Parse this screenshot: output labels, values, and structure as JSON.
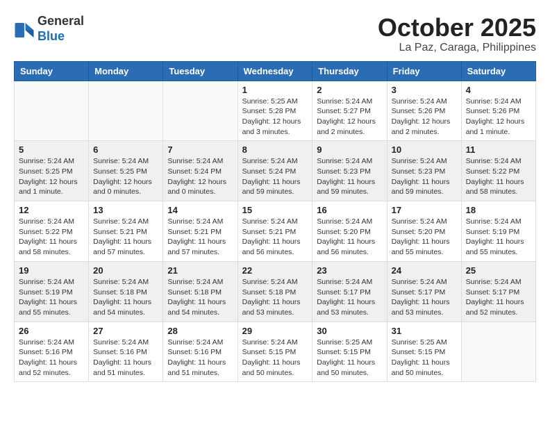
{
  "header": {
    "logo_line1": "General",
    "logo_line2": "Blue",
    "month": "October 2025",
    "location": "La Paz, Caraga, Philippines"
  },
  "weekdays": [
    "Sunday",
    "Monday",
    "Tuesday",
    "Wednesday",
    "Thursday",
    "Friday",
    "Saturday"
  ],
  "weeks": [
    [
      {
        "day": "",
        "sunrise": "",
        "sunset": "",
        "daylight": ""
      },
      {
        "day": "",
        "sunrise": "",
        "sunset": "",
        "daylight": ""
      },
      {
        "day": "",
        "sunrise": "",
        "sunset": "",
        "daylight": ""
      },
      {
        "day": "1",
        "sunrise": "Sunrise: 5:25 AM",
        "sunset": "Sunset: 5:28 PM",
        "daylight": "Daylight: 12 hours and 3 minutes."
      },
      {
        "day": "2",
        "sunrise": "Sunrise: 5:24 AM",
        "sunset": "Sunset: 5:27 PM",
        "daylight": "Daylight: 12 hours and 2 minutes."
      },
      {
        "day": "3",
        "sunrise": "Sunrise: 5:24 AM",
        "sunset": "Sunset: 5:26 PM",
        "daylight": "Daylight: 12 hours and 2 minutes."
      },
      {
        "day": "4",
        "sunrise": "Sunrise: 5:24 AM",
        "sunset": "Sunset: 5:26 PM",
        "daylight": "Daylight: 12 hours and 1 minute."
      }
    ],
    [
      {
        "day": "5",
        "sunrise": "Sunrise: 5:24 AM",
        "sunset": "Sunset: 5:25 PM",
        "daylight": "Daylight: 12 hours and 1 minute."
      },
      {
        "day": "6",
        "sunrise": "Sunrise: 5:24 AM",
        "sunset": "Sunset: 5:25 PM",
        "daylight": "Daylight: 12 hours and 0 minutes."
      },
      {
        "day": "7",
        "sunrise": "Sunrise: 5:24 AM",
        "sunset": "Sunset: 5:24 PM",
        "daylight": "Daylight: 12 hours and 0 minutes."
      },
      {
        "day": "8",
        "sunrise": "Sunrise: 5:24 AM",
        "sunset": "Sunset: 5:24 PM",
        "daylight": "Daylight: 11 hours and 59 minutes."
      },
      {
        "day": "9",
        "sunrise": "Sunrise: 5:24 AM",
        "sunset": "Sunset: 5:23 PM",
        "daylight": "Daylight: 11 hours and 59 minutes."
      },
      {
        "day": "10",
        "sunrise": "Sunrise: 5:24 AM",
        "sunset": "Sunset: 5:23 PM",
        "daylight": "Daylight: 11 hours and 59 minutes."
      },
      {
        "day": "11",
        "sunrise": "Sunrise: 5:24 AM",
        "sunset": "Sunset: 5:22 PM",
        "daylight": "Daylight: 11 hours and 58 minutes."
      }
    ],
    [
      {
        "day": "12",
        "sunrise": "Sunrise: 5:24 AM",
        "sunset": "Sunset: 5:22 PM",
        "daylight": "Daylight: 11 hours and 58 minutes."
      },
      {
        "day": "13",
        "sunrise": "Sunrise: 5:24 AM",
        "sunset": "Sunset: 5:21 PM",
        "daylight": "Daylight: 11 hours and 57 minutes."
      },
      {
        "day": "14",
        "sunrise": "Sunrise: 5:24 AM",
        "sunset": "Sunset: 5:21 PM",
        "daylight": "Daylight: 11 hours and 57 minutes."
      },
      {
        "day": "15",
        "sunrise": "Sunrise: 5:24 AM",
        "sunset": "Sunset: 5:21 PM",
        "daylight": "Daylight: 11 hours and 56 minutes."
      },
      {
        "day": "16",
        "sunrise": "Sunrise: 5:24 AM",
        "sunset": "Sunset: 5:20 PM",
        "daylight": "Daylight: 11 hours and 56 minutes."
      },
      {
        "day": "17",
        "sunrise": "Sunrise: 5:24 AM",
        "sunset": "Sunset: 5:20 PM",
        "daylight": "Daylight: 11 hours and 55 minutes."
      },
      {
        "day": "18",
        "sunrise": "Sunrise: 5:24 AM",
        "sunset": "Sunset: 5:19 PM",
        "daylight": "Daylight: 11 hours and 55 minutes."
      }
    ],
    [
      {
        "day": "19",
        "sunrise": "Sunrise: 5:24 AM",
        "sunset": "Sunset: 5:19 PM",
        "daylight": "Daylight: 11 hours and 55 minutes."
      },
      {
        "day": "20",
        "sunrise": "Sunrise: 5:24 AM",
        "sunset": "Sunset: 5:18 PM",
        "daylight": "Daylight: 11 hours and 54 minutes."
      },
      {
        "day": "21",
        "sunrise": "Sunrise: 5:24 AM",
        "sunset": "Sunset: 5:18 PM",
        "daylight": "Daylight: 11 hours and 54 minutes."
      },
      {
        "day": "22",
        "sunrise": "Sunrise: 5:24 AM",
        "sunset": "Sunset: 5:18 PM",
        "daylight": "Daylight: 11 hours and 53 minutes."
      },
      {
        "day": "23",
        "sunrise": "Sunrise: 5:24 AM",
        "sunset": "Sunset: 5:17 PM",
        "daylight": "Daylight: 11 hours and 53 minutes."
      },
      {
        "day": "24",
        "sunrise": "Sunrise: 5:24 AM",
        "sunset": "Sunset: 5:17 PM",
        "daylight": "Daylight: 11 hours and 53 minutes."
      },
      {
        "day": "25",
        "sunrise": "Sunrise: 5:24 AM",
        "sunset": "Sunset: 5:17 PM",
        "daylight": "Daylight: 11 hours and 52 minutes."
      }
    ],
    [
      {
        "day": "26",
        "sunrise": "Sunrise: 5:24 AM",
        "sunset": "Sunset: 5:16 PM",
        "daylight": "Daylight: 11 hours and 52 minutes."
      },
      {
        "day": "27",
        "sunrise": "Sunrise: 5:24 AM",
        "sunset": "Sunset: 5:16 PM",
        "daylight": "Daylight: 11 hours and 51 minutes."
      },
      {
        "day": "28",
        "sunrise": "Sunrise: 5:24 AM",
        "sunset": "Sunset: 5:16 PM",
        "daylight": "Daylight: 11 hours and 51 minutes."
      },
      {
        "day": "29",
        "sunrise": "Sunrise: 5:24 AM",
        "sunset": "Sunset: 5:15 PM",
        "daylight": "Daylight: 11 hours and 50 minutes."
      },
      {
        "day": "30",
        "sunrise": "Sunrise: 5:25 AM",
        "sunset": "Sunset: 5:15 PM",
        "daylight": "Daylight: 11 hours and 50 minutes."
      },
      {
        "day": "31",
        "sunrise": "Sunrise: 5:25 AM",
        "sunset": "Sunset: 5:15 PM",
        "daylight": "Daylight: 11 hours and 50 minutes."
      },
      {
        "day": "",
        "sunrise": "",
        "sunset": "",
        "daylight": ""
      }
    ]
  ]
}
